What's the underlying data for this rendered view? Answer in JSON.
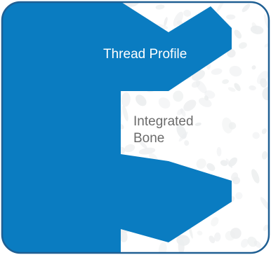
{
  "labels": {
    "thread_profile": "Thread Profile",
    "integrated_bone_line1": "Integrated",
    "integrated_bone_line2": "Bone"
  },
  "colors": {
    "thread_blue": "#0a7cc1",
    "border_blue": "#1f5f93",
    "bone_background": "#ffffff",
    "bone_texture": "#eceeef",
    "bone_label": "#6b6b6b",
    "thread_label": "#ffffff"
  }
}
